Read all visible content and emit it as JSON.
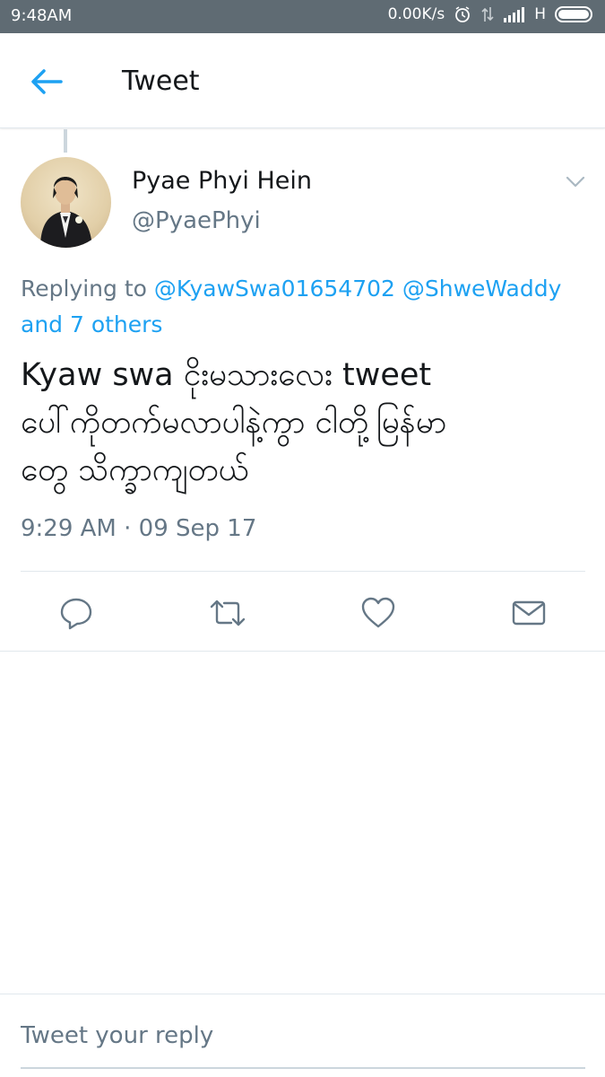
{
  "status_bar": {
    "time": "9:48AM",
    "network_speed": "0.00K/s",
    "network_type": "H",
    "icons": [
      "alarm-icon",
      "data-transfer-icon",
      "signal-icon",
      "battery-icon"
    ]
  },
  "header": {
    "title": "Tweet",
    "back_icon": "arrow-left-icon"
  },
  "tweet": {
    "author_name": "Pyae Phyi Hein",
    "author_handle": "@PyaePhyi",
    "menu_icon": "chevron-down-icon",
    "replying_prefix": "Replying to",
    "reply_mentions": [
      "@KyawSwa01654702",
      "@ShweWaddy"
    ],
    "reply_others": "and 7 others",
    "text_line_1": "Kyaw swa ငိုးမသားလေး tweet",
    "text_line_2": "ပေါ်ကိုတက်မလာပါနဲ့ကွာ ငါတို့မြန်မာ",
    "text_line_3": "တွေ သိက္ခာကျတယ်",
    "timestamp": "9:29 AM · 09 Sep 17"
  },
  "actions": [
    "reply-icon",
    "retweet-icon",
    "like-icon",
    "direct-message-icon"
  ],
  "reply_box": {
    "placeholder": "Tweet your reply"
  },
  "colors": {
    "accent": "#1da1f2",
    "status_bar": "#5f6b73",
    "secondary_text": "#657786",
    "primary_text": "#14171a",
    "divider": "#e1e8ed"
  }
}
